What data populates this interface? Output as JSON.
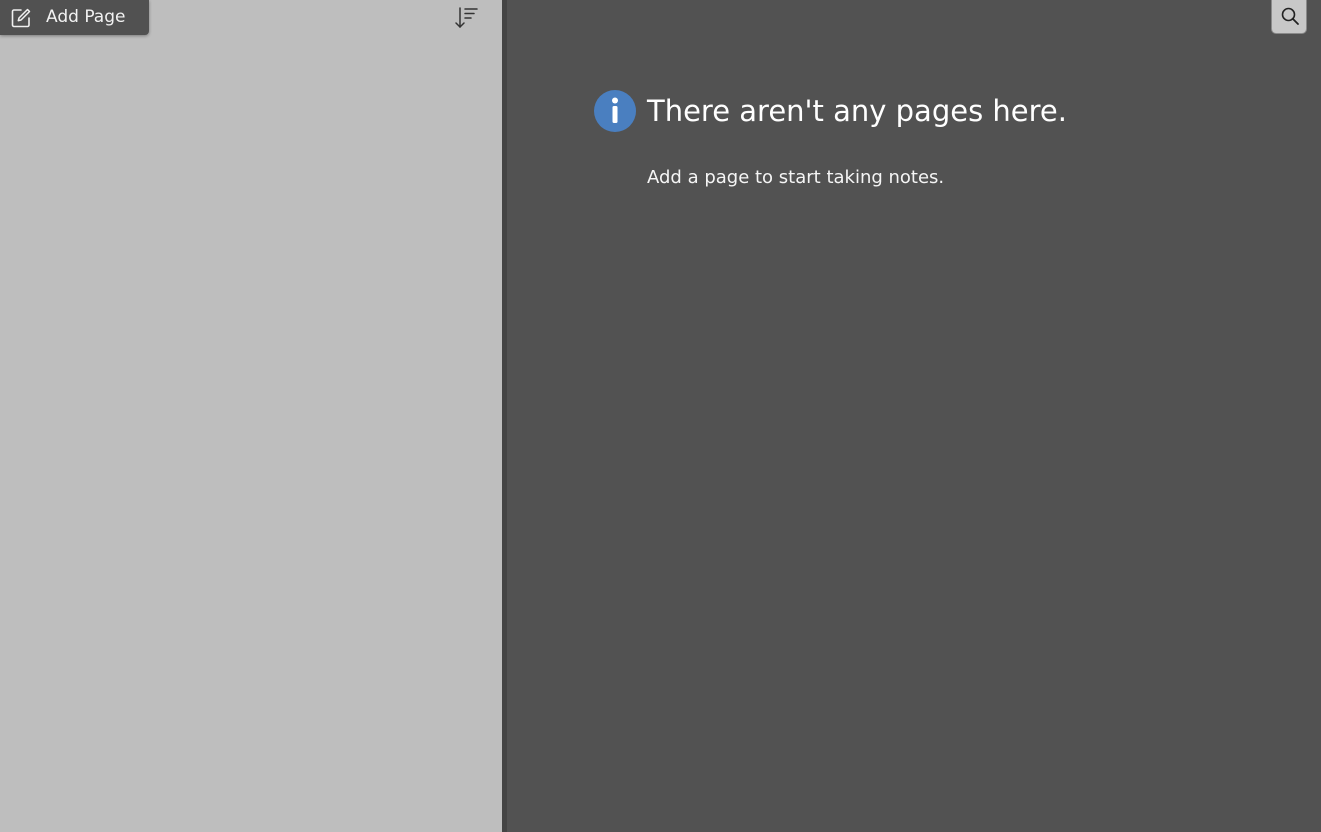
{
  "toolbar": {
    "add_page_label": "Add Page",
    "add_page_icon": "edit-icon",
    "sort_icon": "sort-icon",
    "search_icon": "search-icon"
  },
  "empty_state": {
    "icon": "info-icon",
    "title": "There aren't any pages here.",
    "subtitle": "Add a page to start taking notes."
  },
  "colors": {
    "page_list_background": "#bebebe",
    "content_background": "#525252",
    "info_icon": "#4a7fc0"
  }
}
